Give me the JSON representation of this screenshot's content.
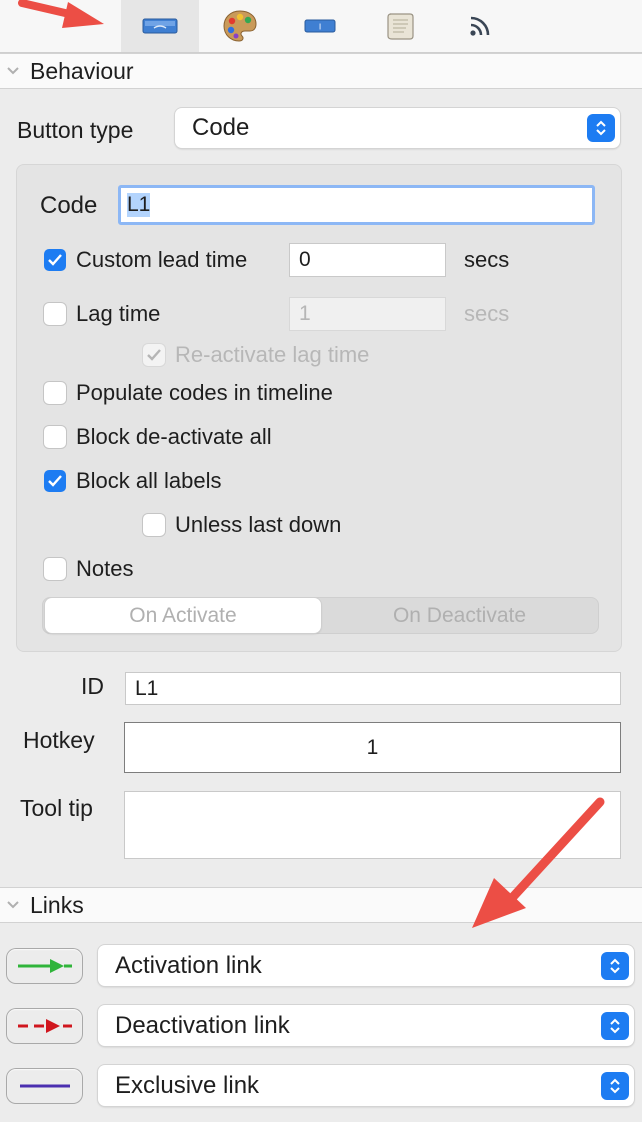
{
  "toolbar": {
    "tabs": [
      {
        "name": "behaviour-tab-icon"
      },
      {
        "name": "appearance-palette-icon"
      },
      {
        "name": "label-tab-icon"
      },
      {
        "name": "script-tab-icon"
      },
      {
        "name": "broadcast-tab-icon"
      }
    ],
    "selected_index": 0
  },
  "behaviour": {
    "section_title": "Behaviour",
    "button_type_label": "Button type",
    "button_type_value": "Code",
    "code_label": "Code",
    "code_value": "L1",
    "custom_lead_time": {
      "label": "Custom lead time",
      "checked": true,
      "value": "0",
      "unit": "secs"
    },
    "lag_time": {
      "label": "Lag time",
      "checked": false,
      "value": "1",
      "unit": "secs",
      "disabled_field": true
    },
    "reactivate_lag_time": {
      "label": "Re-activate lag time",
      "checked": true,
      "disabled": true
    },
    "populate_codes": {
      "label": "Populate codes in timeline",
      "checked": false
    },
    "block_deactivate_all": {
      "label": "Block de-activate all",
      "checked": false
    },
    "block_all_labels": {
      "label": "Block all labels",
      "checked": true
    },
    "unless_last_down": {
      "label": "Unless last down",
      "checked": false
    },
    "notes": {
      "label": "Notes",
      "checked": false
    },
    "segments": [
      "On Activate",
      "On Deactivate"
    ],
    "selected_segment": "On Activate",
    "id_label": "ID",
    "id_value": "L1",
    "hotkey_label": "Hotkey",
    "hotkey_value": "1",
    "tooltip_label": "Tool tip",
    "tooltip_value": ""
  },
  "links": {
    "section_title": "Links",
    "items": [
      {
        "label": "Activation link",
        "color": "#2fb43a",
        "style": "solid-arrow"
      },
      {
        "label": "Deactivation link",
        "color": "#d0161e",
        "style": "dashed-arrow"
      },
      {
        "label": "Exclusive link",
        "color": "#4b2fb0",
        "style": "solid-line"
      }
    ]
  },
  "colors": {
    "accent": "#1d7cf2",
    "annotation_arrow": "#ec4e45"
  }
}
